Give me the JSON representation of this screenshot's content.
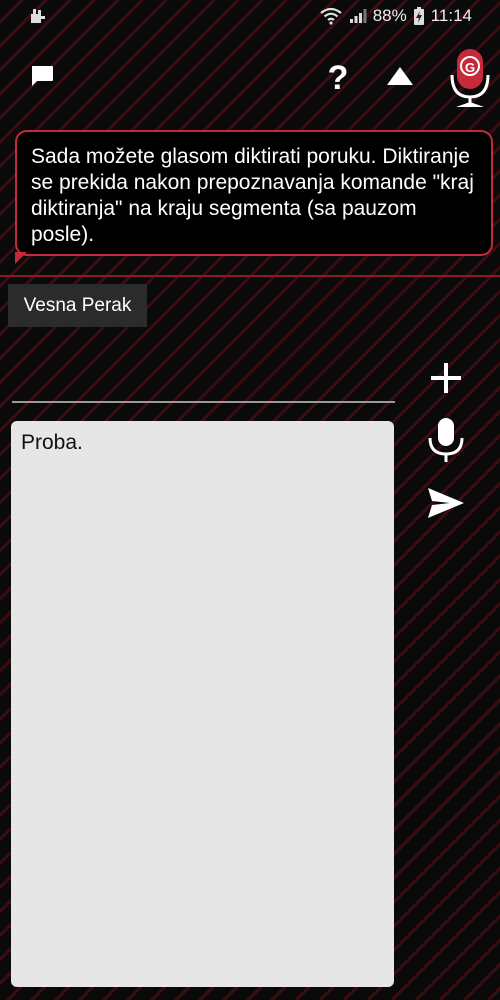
{
  "status_bar": {
    "battery": "88%",
    "time": "11:14"
  },
  "toolbar": {
    "help_label": "?",
    "mic_badge": "G"
  },
  "message": {
    "text": "Sada možete glasom diktirati poruku. Diktiranje se prekida nakon prepoznavanja komande \"kraj diktiranja\" na kraju segmenta (sa pauzom posle)."
  },
  "contact": {
    "name": "Vesna Perak"
  },
  "composer": {
    "subject_value": "",
    "body_value": "Proba."
  },
  "colors": {
    "accent": "#c62a3a",
    "background": "#0a0a0a",
    "stripe": "#3a0d12",
    "text_area_bg": "#e6e6e6"
  },
  "icons": {
    "status_left": "notification-icon",
    "wifi": "wifi-icon",
    "signal": "signal-icon",
    "battery": "battery-charging-icon",
    "chat": "chat-icon",
    "help": "help-icon",
    "collapse": "triangle-up-icon",
    "mic_brand": "mic-g-icon",
    "add": "plus-icon",
    "mic": "mic-icon",
    "send": "send-icon"
  }
}
